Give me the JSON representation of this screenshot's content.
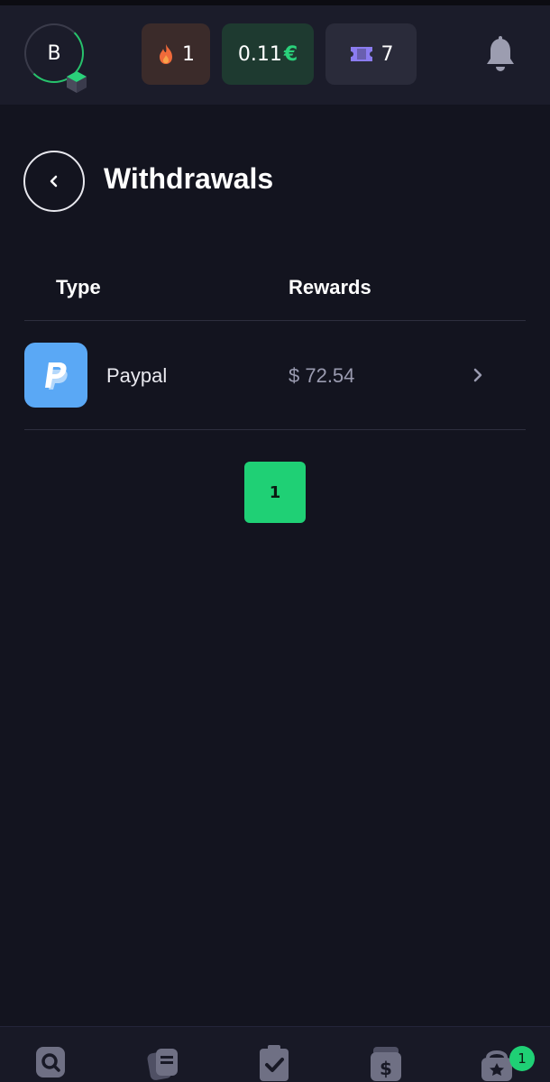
{
  "header": {
    "avatar_initial": "B",
    "streak_value": "1",
    "balance_value": "0.11",
    "currency_symbol": "€",
    "tickets_value": "7",
    "icons": [
      "level-badge-icon",
      "flame-icon",
      "ticket-icon",
      "bell-icon"
    ]
  },
  "page": {
    "title": "Withdrawals"
  },
  "table": {
    "columns": [
      "Type",
      "Rewards"
    ],
    "rows": [
      {
        "type": "Paypal",
        "reward": "$ 72.54",
        "icon": "paypal-icon"
      }
    ]
  },
  "pagination": {
    "current_page": "1"
  },
  "bottom_nav": {
    "items": [
      "search-icon",
      "offers-icon",
      "tasks-icon",
      "cashout-icon",
      "rewards-icon"
    ],
    "rewards_badge": "1"
  },
  "colors": {
    "background": "#13141f",
    "header": "#1b1c2a",
    "accent_green": "#1fd075",
    "paypal_blue": "#5aa8f5"
  }
}
